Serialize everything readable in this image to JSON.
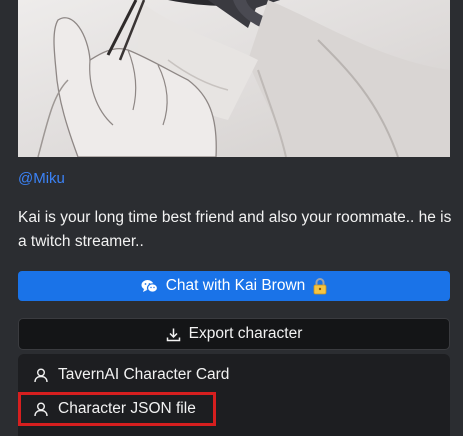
{
  "creator": {
    "handle": "@Miku"
  },
  "character": {
    "description": "Kai is your long time best friend and also your roommate.. he is a twitch streamer.."
  },
  "actions": {
    "chat_label": "Chat with Kai Brown",
    "chat_icon": "wechat-icon",
    "chat_badge": "lock-emoji",
    "export_label": "Export character",
    "export_icon": "download-icon"
  },
  "export_menu": {
    "items": [
      {
        "label": "TavernAI Character Card",
        "icon": "user-icon"
      },
      {
        "label": "Character JSON file",
        "icon": "user-icon",
        "highlighted": true
      }
    ]
  },
  "colors": {
    "background": "#2b2d31",
    "link": "#3b82f6",
    "primary_button": "#1a73e8",
    "dark_button": "#141517",
    "menu": "#1d1e21",
    "highlight": "#d61f1f"
  }
}
